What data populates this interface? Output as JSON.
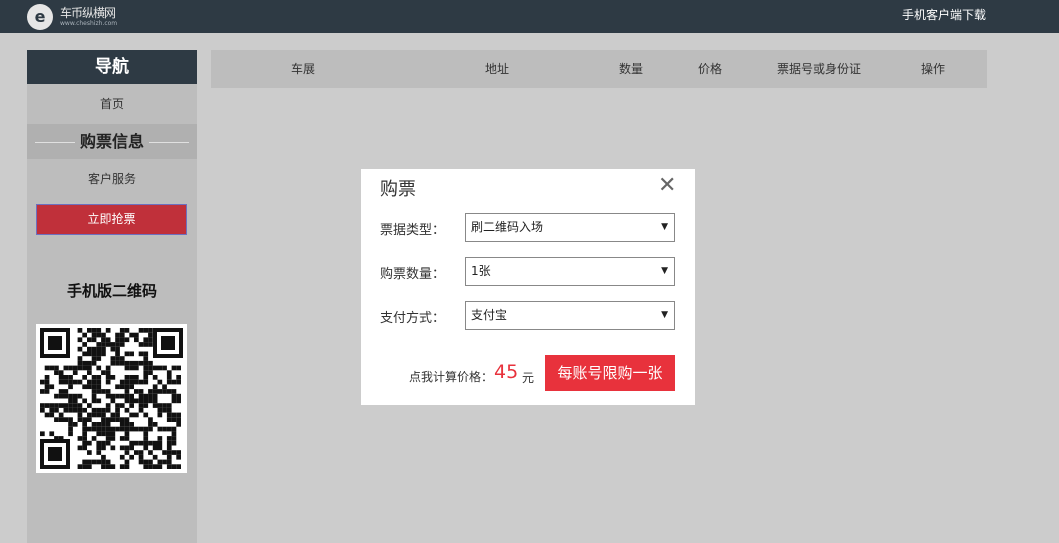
{
  "header": {
    "logo_mark": "e",
    "logo_name": "车币纵横网",
    "logo_url": "www.cheshizh.com",
    "download_label": "手机客户端下载"
  },
  "sidebar": {
    "title": "导航",
    "home_label": "首页",
    "section_title": "购票信息",
    "service_label": "客户服务",
    "grab_button": "立即抢票",
    "qr_title": "手机版二维码"
  },
  "table": {
    "columns": [
      "车展",
      "地址",
      "数量",
      "价格",
      "票据号或身份证",
      "操作"
    ]
  },
  "modal": {
    "title": "购票",
    "close_icon": "close-icon",
    "fields": [
      {
        "label": "票据类型：",
        "value": "刷二维码入场"
      },
      {
        "label": "购票数量：",
        "value": "1张"
      },
      {
        "label": "支付方式：",
        "value": "支付宝"
      }
    ],
    "calc_label": "点我计算价格：",
    "price": "45",
    "unit": "元",
    "limit_button": "每账号限购一张"
  },
  "colors": {
    "topbar": "#2e3a44",
    "accent_red": "#e8323c",
    "grab_red": "#c0303a"
  }
}
